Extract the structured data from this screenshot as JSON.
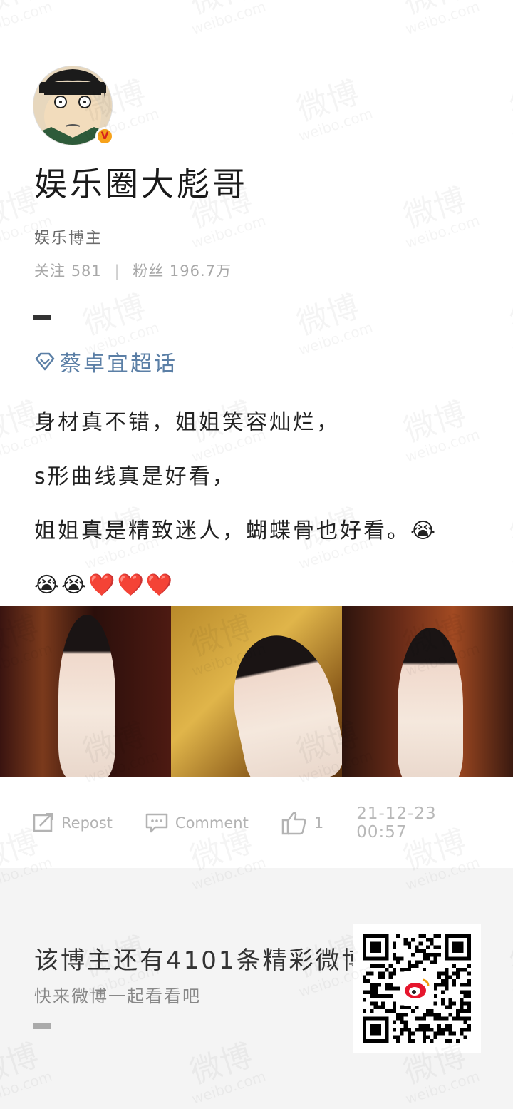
{
  "profile": {
    "name": "娱乐圈大彪哥",
    "role": "娱乐博主",
    "following_label": "关注",
    "following_count": "581",
    "followers_label": "粉丝",
    "followers_count": "196.7万"
  },
  "post": {
    "topic": "蔡卓宜超话",
    "lines": [
      "身材真不错，姐姐笑容灿烂，",
      "s形曲线真是好看，",
      "姐姐真是精致迷人，蝴蝶骨也好看。😭"
    ],
    "emoji_line": "😭😭❤️❤️❤️"
  },
  "actions": {
    "repost_label": "Repost",
    "comment_label": "Comment",
    "like_count": "1",
    "timestamp": "21-12-23 00:57"
  },
  "footer": {
    "title": "该博主还有4101条精彩微博",
    "subtitle": "快来微博一起看看吧"
  },
  "colors": {
    "topic": "#5b7fa6",
    "verified_badge": "#f7a21b",
    "footer_bg": "#f4f4f4"
  },
  "watermark": {
    "brand": "微博",
    "domain": "weibo.com"
  }
}
